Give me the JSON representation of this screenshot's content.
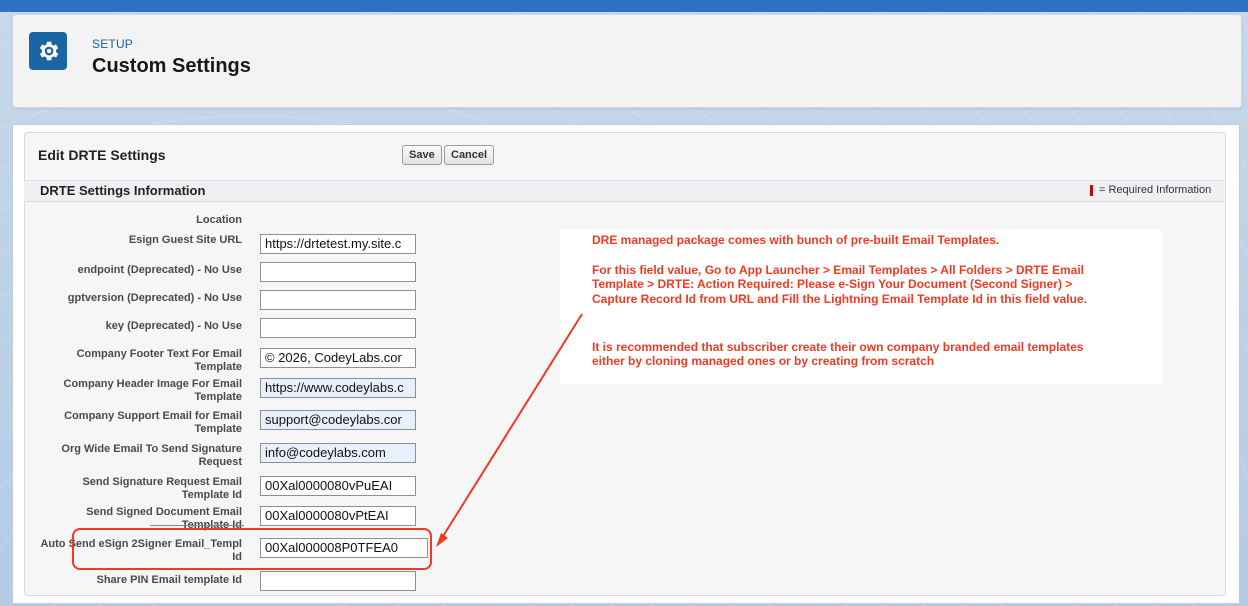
{
  "header": {
    "setup_label": "SETUP",
    "title": "Custom Settings",
    "icon": "gear-icon"
  },
  "form": {
    "title": "Edit DRTE Settings",
    "save_label": "Save",
    "cancel_label": "Cancel",
    "section_title": "DRTE Settings Information",
    "required_legend": "= Required Information"
  },
  "fields": [
    {
      "label": "Location",
      "value": null
    },
    {
      "label": "Esign Guest Site URL",
      "value": "https://drtetest.my.site.c"
    },
    {
      "label": "endpoint (Deprecated) - No Use",
      "value": ""
    },
    {
      "label": "gptversion (Deprecated) - No Use",
      "value": ""
    },
    {
      "label": "key (Deprecated) - No Use",
      "value": ""
    },
    {
      "label": "Company Footer Text For Email Template",
      "value": "© 2026, CodeyLabs.cor"
    },
    {
      "label": "Company Header Image For Email Template",
      "value": "https://www.codeylabs.c"
    },
    {
      "label": "Company Support Email for Email Template",
      "value": "support@codeylabs.cor"
    },
    {
      "label": "Org Wide Email To Send Signature Request",
      "value": "info@codeylabs.com"
    },
    {
      "label": "Send Signature Request Email Template Id",
      "value": "00Xal0000080vPuEAI"
    },
    {
      "label": "Send Signed Document Email Template Id",
      "value": "00Xal0000080vPtEAI"
    },
    {
      "label": "Auto Send eSign 2Signer Email_Templ Id",
      "value": "00Xal000008P0TFEA0"
    },
    {
      "label": "Share PIN Email template Id",
      "value": ""
    }
  ],
  "note": {
    "line1": "DRE managed package comes with bunch of pre-built Email Templates.",
    "line2": "For this field value, Go to App Launcher > Email Templates > All Folders > DRTE Email",
    "line3": "Template > DRTE: Action Required: Please e-Sign Your Document (Second Signer) >",
    "line4": "Capture Record Id from URL and Fill the Lightning Email Template Id in this field value.",
    "line5": "It is recommended that subscriber create their own company branded email templates",
    "line6": "either by cloning managed ones or by creating from scratch"
  },
  "colors": {
    "accent": "#1c65a5",
    "annotation": "#ee3b23",
    "required": "#cc0000"
  }
}
